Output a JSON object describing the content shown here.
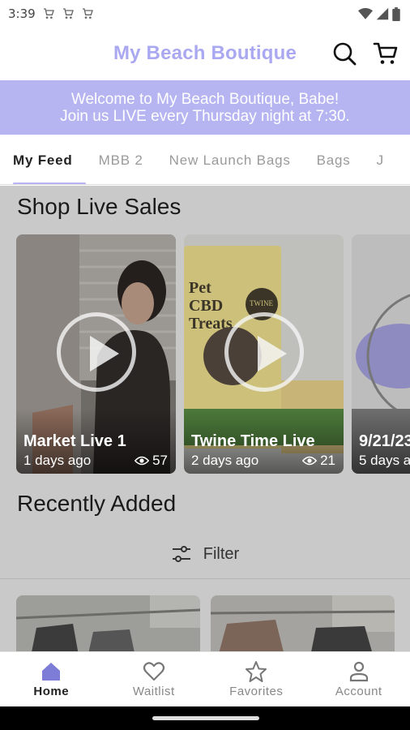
{
  "status_bar": {
    "time": "3:39"
  },
  "app": {
    "title": "My Beach Boutique"
  },
  "banner": {
    "line1": "Welcome to My Beach Boutique, Babe!",
    "line2": "Join us LIVE every Thursday night at 7:30."
  },
  "tabs": [
    {
      "label": "My Feed",
      "active": true
    },
    {
      "label": "MBB 2"
    },
    {
      "label": "New Launch Bags"
    },
    {
      "label": "Bags"
    },
    {
      "label": "J"
    }
  ],
  "live_sales": {
    "title": "Shop Live Sales",
    "cards": [
      {
        "title": "Market Live 1",
        "ago": "1 days ago",
        "views": "57"
      },
      {
        "title": "Twine Time Live",
        "ago": "2 days ago",
        "views": "21",
        "thumb_text": "Pet CBD Treats",
        "brand": "TWINE"
      },
      {
        "title": "9/21/23",
        "ago": "5 days a"
      }
    ]
  },
  "recently_added": {
    "title": "Recently Added",
    "filter_label": "Filter"
  },
  "bottom_nav": [
    {
      "label": "Home",
      "icon": "home-icon",
      "active": true
    },
    {
      "label": "Waitlist",
      "icon": "heart-icon"
    },
    {
      "label": "Favorites",
      "icon": "star-icon"
    },
    {
      "label": "Account",
      "icon": "person-icon"
    }
  ],
  "colors": {
    "accent": "#a9a8f0",
    "banner": "#b6b5f2"
  }
}
